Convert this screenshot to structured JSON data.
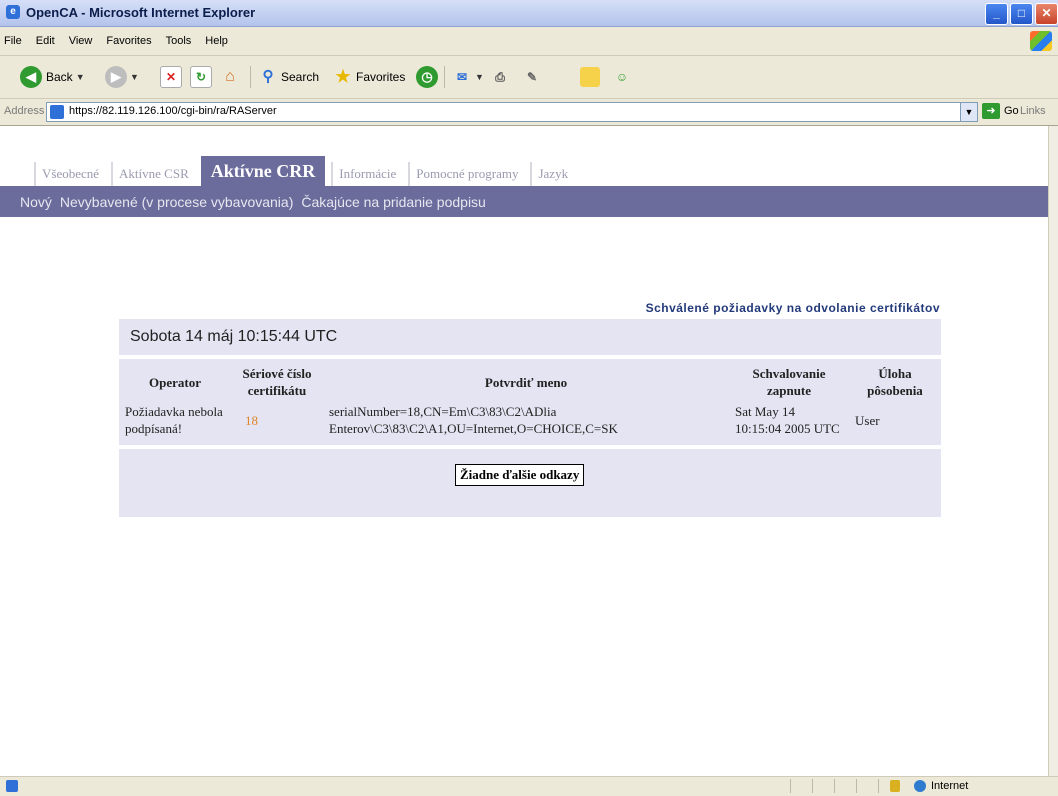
{
  "window": {
    "title": "OpenCA - Microsoft Internet Explorer"
  },
  "menu": [
    "File",
    "Edit",
    "View",
    "Favorites",
    "Tools",
    "Help"
  ],
  "toolbar": {
    "back_label": "Back",
    "search_label": "Search",
    "favorites_label": "Favorites"
  },
  "address": {
    "label": "Address",
    "url": "https://82.119.126.100/cgi-bin/ra/RAServer",
    "go_label": "Go",
    "links_label": "Links"
  },
  "tabs": [
    {
      "label": "Všeobecné",
      "active": false
    },
    {
      "label": "Aktívne CSR",
      "active": false
    },
    {
      "label": "Aktívne CRR",
      "active": true
    },
    {
      "label": "Informácie",
      "active": false
    },
    {
      "label": "Pomocné programy",
      "active": false
    },
    {
      "label": "Jazyk",
      "active": false
    }
  ],
  "subnav": [
    "Nový",
    "Nevybavené (v procese vybavovania)",
    "Čakajúce na pridanie podpisu"
  ],
  "main": {
    "heading": "Schválené požiadavky na odvolanie certifikátov",
    "date": "Sobota 14 máj 10:15:44 UTC",
    "columns": [
      "Operator",
      "Sériové číslo certifikátu",
      "Potvrdiť meno",
      "Schvalovanie zapnute",
      "Úloha pôsobenia"
    ],
    "rows": [
      {
        "operator": "Požiadavka nebola podpísaná!",
        "serial": "18",
        "name": "serialNumber=18,CN=Em\\C3\\83\\C2\\ADlia Enterov\\C3\\83\\C2\\A1,OU=Internet,O=CHOICE,C=SK",
        "approved": "Sat May 14 10:15:04 2005 UTC",
        "role": "User"
      }
    ],
    "no_links_button": "Žiadne ďalšie odkazy"
  },
  "status": {
    "zone": "Internet"
  },
  "colors": {
    "nav_bar": "#6c6c9c",
    "panel_bg": "#e4e4f2",
    "heading": "#233a7a",
    "serial": "#e0852a"
  }
}
